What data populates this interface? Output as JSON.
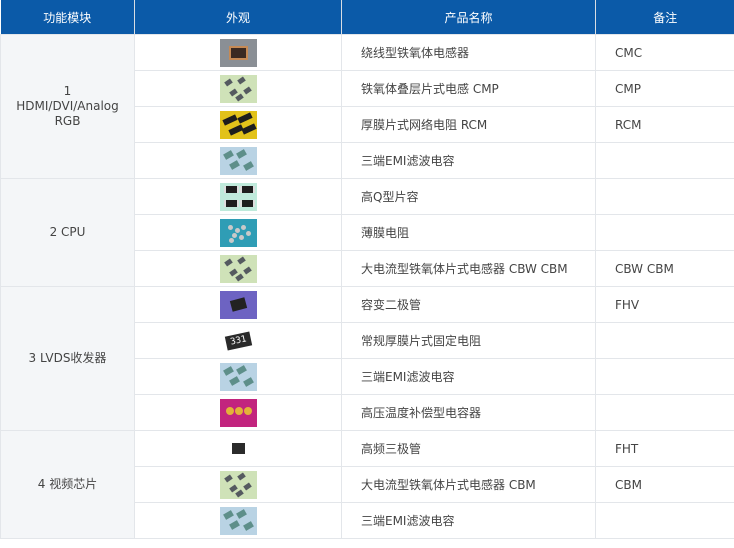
{
  "header": {
    "col_module": "功能模块",
    "col_image": "外观",
    "col_name": "产品名称",
    "col_note": "备注"
  },
  "groups": [
    {
      "module": "1 HDMI/DVI/Analog RGB",
      "rows": [
        {
          "icon": "common-mode-choke-icon",
          "name": "绕线型铁氧体电感器",
          "note": "CMC"
        },
        {
          "icon": "chip-inductor-icon",
          "name": "铁氧体叠层片式电感 CMP",
          "note": "CMP"
        },
        {
          "icon": "resistor-network-icon",
          "name": "厚膜片式网络电阻 RCM",
          "note": "RCM"
        },
        {
          "icon": "emi-filter-capacitor-icon",
          "name": "三端EMI滤波电容",
          "note": ""
        }
      ]
    },
    {
      "module": "2 CPU",
      "rows": [
        {
          "icon": "high-q-capacitor-icon",
          "name": "高Q型片容",
          "note": ""
        },
        {
          "icon": "thin-film-resistor-icon",
          "name": "薄膜电阻",
          "note": ""
        },
        {
          "icon": "chip-inductor-icon",
          "name": "大电流型铁氧体片式电感器 CBW CBM",
          "note": "CBW CBM"
        }
      ]
    },
    {
      "module": "3 LVDS收发器",
      "rows": [
        {
          "icon": "varactor-diode-icon",
          "name": "容变二极管",
          "note": "FHV"
        },
        {
          "icon": "chip-resistor-icon",
          "name": "常规厚膜片式固定电阻",
          "note": ""
        },
        {
          "icon": "emi-filter-capacitor-icon",
          "name": "三端EMI滤波电容",
          "note": ""
        },
        {
          "icon": "hv-capacitor-icon",
          "name": "高压温度补偿型电容器",
          "note": ""
        }
      ]
    },
    {
      "module": "4 视频芯片",
      "rows": [
        {
          "icon": "transistor-icon",
          "name": "高频三极管",
          "note": "FHT"
        },
        {
          "icon": "chip-inductor-icon",
          "name": "大电流型铁氧体片式电感器 CBM",
          "note": "CBM"
        },
        {
          "icon": "emi-filter-capacitor-icon",
          "name": "三端EMI滤波电容",
          "note": ""
        }
      ]
    }
  ]
}
